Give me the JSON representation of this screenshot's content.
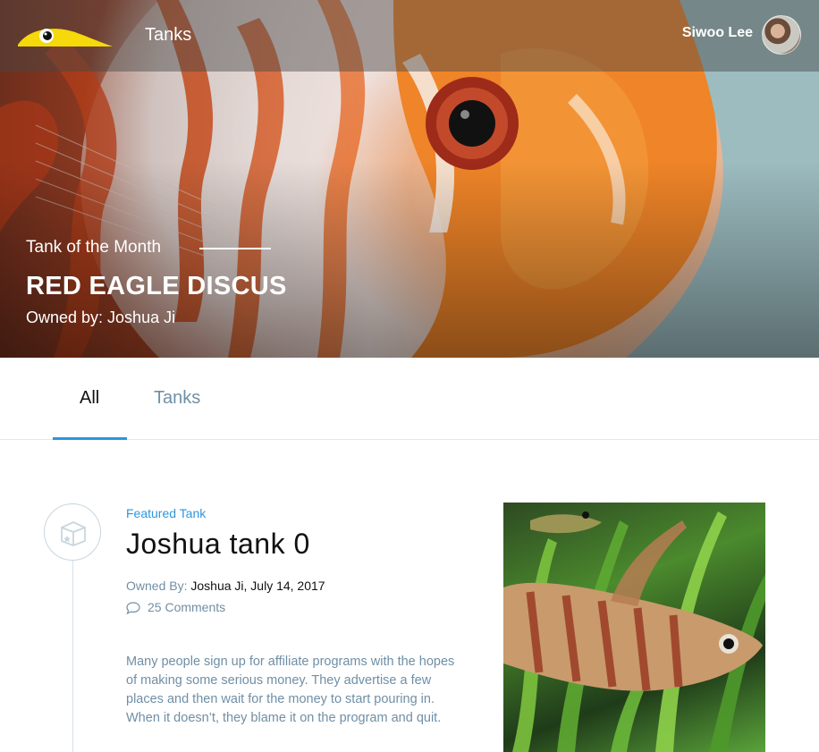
{
  "topbar": {
    "logo_icon": "bird-logo-icon",
    "nav_link": "Tanks",
    "user_name": "Siwoo Lee",
    "avatar_icon": "user-avatar"
  },
  "hero": {
    "kicker": "Tank of the Month",
    "title": "RED EAGLE DISCUS",
    "owner": "Owned by: Joshua Ji"
  },
  "tabs": [
    {
      "label": "All",
      "active": true
    },
    {
      "label": "Tanks",
      "active": false
    }
  ],
  "post": {
    "category": "Featured Tank",
    "title": "Joshua tank 0",
    "owned_by_label": "Owned By:",
    "owner_date": " Joshua Ji, July 14, 2017",
    "comments": "25 Comments",
    "excerpt": "Many people sign up for affiliate programs with the hopes of making some serious money. They advertise a few places and then wait for the money to start pouring in. When it doesn’t, they blame it on the program and quit.",
    "icon": "box-star-icon",
    "comment_icon": "speech-bubble-icon"
  },
  "colors": {
    "accent": "#2f95dc",
    "muted": "#6f8fa6",
    "logo_yellow": "#f5d90a"
  }
}
